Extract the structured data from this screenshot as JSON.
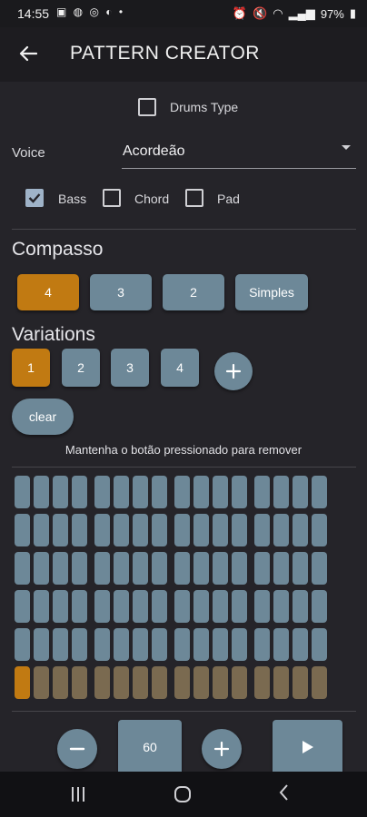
{
  "status": {
    "time": "14:55",
    "battery": "97%"
  },
  "appbar": {
    "title": "PATTERN CREATOR"
  },
  "drums_type": {
    "label": "Drums Type",
    "checked": false
  },
  "voice": {
    "label": "Voice",
    "value": "Acordeão"
  },
  "instruments": [
    {
      "label": "Bass",
      "checked": true
    },
    {
      "label": "Chord",
      "checked": false
    },
    {
      "label": "Pad",
      "checked": false
    }
  ],
  "compasso": {
    "title": "Compasso",
    "options": [
      "4",
      "3",
      "2",
      "Simples"
    ],
    "selected": "4"
  },
  "variations": {
    "title": "Variations",
    "options": [
      "1",
      "2",
      "3",
      "4"
    ],
    "selected": "1"
  },
  "clear_label": "clear",
  "hint": "Mantenha o botão pressionado para remover",
  "grid": {
    "rows": 6,
    "cols": 16,
    "accent_row": 5,
    "active": [
      [
        5,
        0
      ]
    ]
  },
  "tempo": {
    "value": "60"
  },
  "colors": {
    "accent": "#c17a12",
    "button": "#6d8898",
    "background": "#252429",
    "step_off": "#7a6a50"
  }
}
